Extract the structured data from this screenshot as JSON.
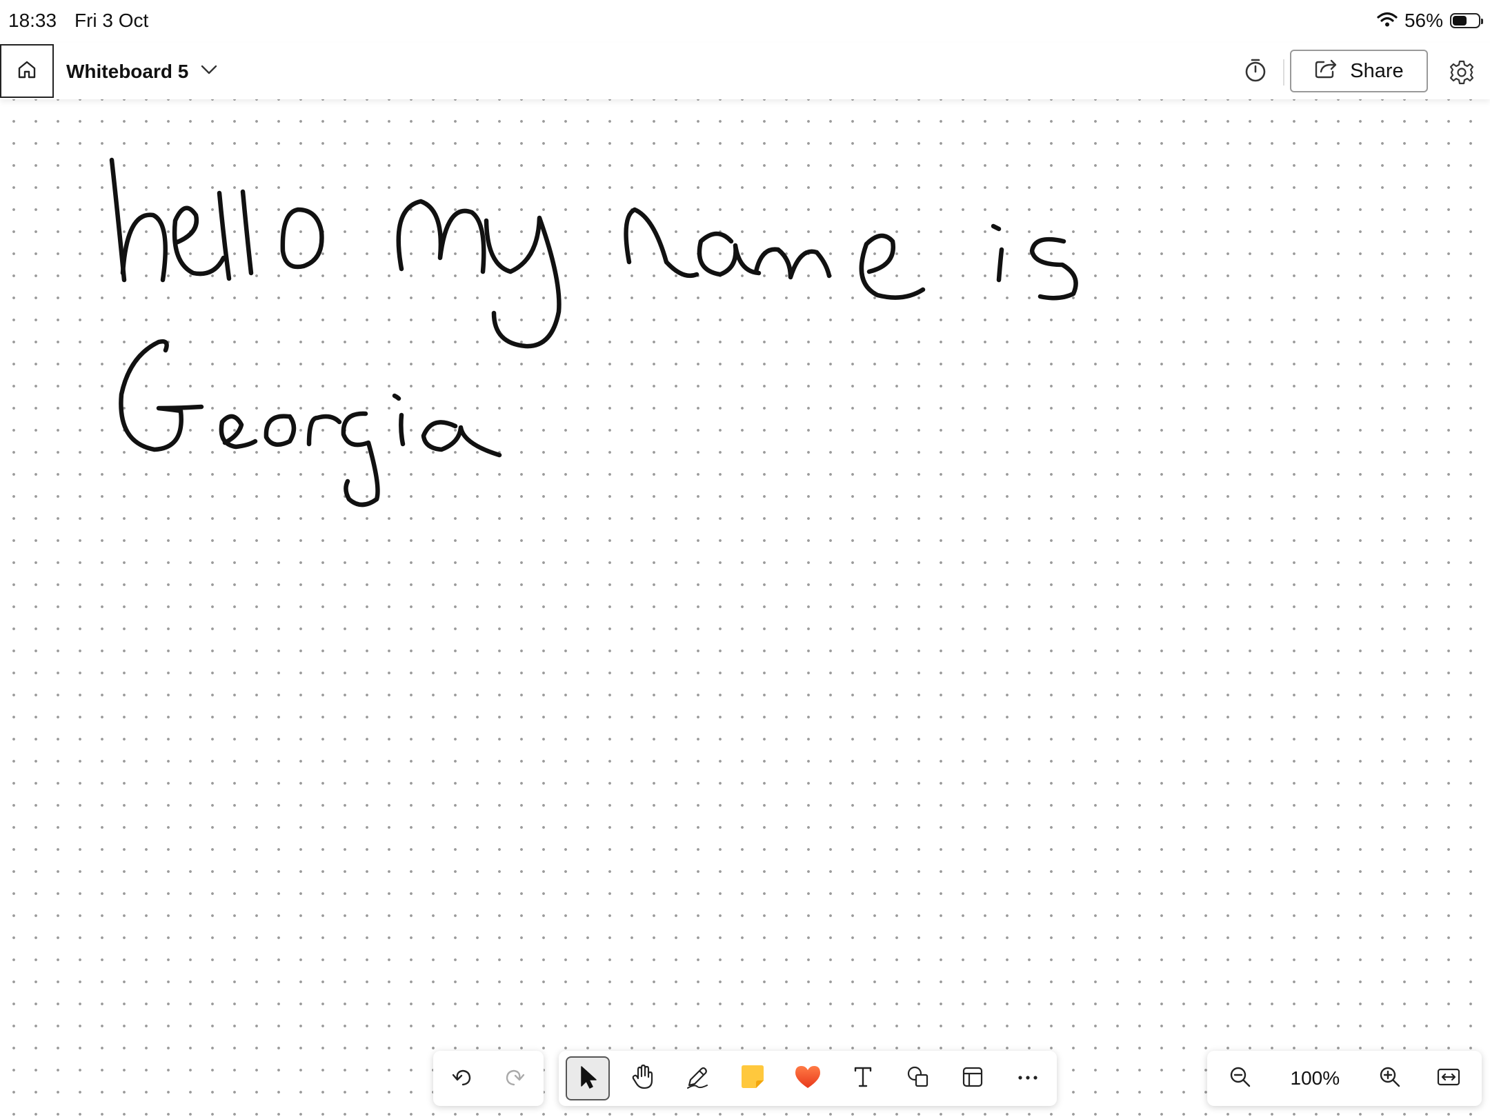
{
  "status_bar": {
    "time": "18:33",
    "date": "Fri 3 Oct",
    "battery_percent": "56%",
    "battery_level": 0.56
  },
  "header": {
    "home_icon": "home-icon",
    "title": "Whiteboard 5",
    "title_dropdown_icon": "chevron-down-icon",
    "timer_icon": "timer-icon",
    "share_label": "Share",
    "share_icon": "share-icon",
    "settings_icon": "gear-icon"
  },
  "canvas": {
    "background": "dot-grid",
    "handwriting": [
      "hello my name is",
      "Georgia"
    ]
  },
  "toolbar": {
    "undo_icon": "undo-icon",
    "redo_icon": "redo-icon",
    "tools": [
      {
        "name": "select",
        "icon": "pointer-icon",
        "active": true
      },
      {
        "name": "pan",
        "icon": "hand-icon",
        "active": false
      },
      {
        "name": "pen",
        "icon": "pen-icon",
        "active": false
      },
      {
        "name": "note",
        "icon": "sticky-note-icon",
        "active": false
      },
      {
        "name": "reactions",
        "icon": "heart-icon",
        "active": false
      },
      {
        "name": "text",
        "icon": "text-icon",
        "active": false
      },
      {
        "name": "shapes",
        "icon": "shapes-icon",
        "active": false
      },
      {
        "name": "templates",
        "icon": "template-icon",
        "active": false
      },
      {
        "name": "more",
        "icon": "more-icon",
        "active": false
      }
    ],
    "sticky_color": "#FFC83D",
    "heart_color": "#F25022"
  },
  "zoom": {
    "zoom_out_icon": "zoom-out-icon",
    "level": "100%",
    "zoom_in_icon": "zoom-in-icon",
    "fit_icon": "fit-width-icon"
  }
}
